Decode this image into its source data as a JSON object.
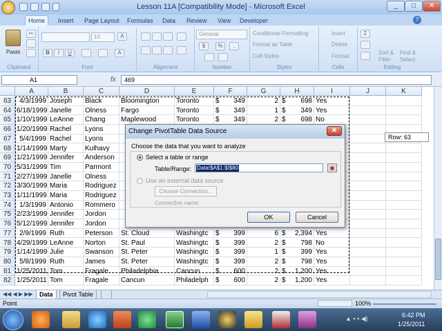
{
  "window": {
    "title": "Lesson 11A  [Compatibility Mode] - Microsoft Excel"
  },
  "ribbon": {
    "tabs": [
      "Home",
      "Insert",
      "Page Layout",
      "Formulas",
      "Data",
      "Review",
      "View",
      "Developer"
    ],
    "groups": {
      "clipboard": {
        "label": "Clipboard",
        "paste": "Paste"
      },
      "font": {
        "label": "Font",
        "size": "10"
      },
      "alignment": {
        "label": "Alignment"
      },
      "number": {
        "label": "Number",
        "format": "General"
      },
      "styles": {
        "label": "Styles",
        "conditional": "Conditional Formatting",
        "table": "Format as Table",
        "cell": "Cell Styles"
      },
      "cells": {
        "label": "Cells",
        "insert": "Insert",
        "delete": "Delete",
        "format": "Format"
      },
      "editing": {
        "label": "Editing",
        "sort": "Sort &",
        "sort2": "Filter",
        "find": "Find &",
        "find2": "Select"
      }
    }
  },
  "formula": {
    "namebox": "A1",
    "fx": "fx",
    "value": "469"
  },
  "grid": {
    "columns": [
      "A",
      "B",
      "C",
      "D",
      "E",
      "F",
      "G",
      "H",
      "I",
      "J",
      "K"
    ],
    "rows": [
      {
        "n": "63",
        "a": "4/3/1999",
        "b": "Joseph",
        "c": "Black",
        "d": "Bloomington",
        "e": "Toronto",
        "f1": "$",
        "f2": "349",
        "g": "2",
        "h1": "$",
        "h2": "698",
        "i": "Yes"
      },
      {
        "n": "64",
        "a": "6/18/1999",
        "b": "Janelle",
        "c": "Olness",
        "d": "Fargo",
        "e": "Toronto",
        "f1": "$",
        "f2": "349",
        "g": "1",
        "h1": "$",
        "h2": "349",
        "i": "Yes"
      },
      {
        "n": "65",
        "a": "1/10/1999",
        "b": "LeAnne",
        "c": "Chang",
        "d": "Maplewood",
        "e": "Toronto",
        "f1": "$",
        "f2": "349",
        "g": "2",
        "h1": "$",
        "h2": "698",
        "i": "No"
      },
      {
        "n": "66",
        "a": "1/20/1999",
        "b": "Rachel",
        "c": "Lyons",
        "d": "",
        "e": "",
        "f1": "",
        "f2": "",
        "g": "",
        "h1": "",
        "h2": "",
        "i": ""
      },
      {
        "n": "67",
        "a": "5/4/1999",
        "b": "Rachel",
        "c": "Lyons",
        "d": "",
        "e": "",
        "f1": "",
        "f2": "",
        "g": "",
        "h1": "",
        "h2": "",
        "i": ""
      },
      {
        "n": "68",
        "a": "1/14/1999",
        "b": "Marty",
        "c": "Kulhavy",
        "d": "",
        "e": "",
        "f1": "",
        "f2": "",
        "g": "",
        "h1": "",
        "h2": "",
        "i": ""
      },
      {
        "n": "69",
        "a": "1/21/1999",
        "b": "Jennifer",
        "c": "Anderson",
        "d": "",
        "e": "",
        "f1": "",
        "f2": "",
        "g": "",
        "h1": "",
        "h2": "",
        "i": ""
      },
      {
        "n": "70",
        "a": "5/31/1999",
        "b": "Tim",
        "c": "Parmont",
        "d": "",
        "e": "",
        "f1": "",
        "f2": "",
        "g": "",
        "h1": "",
        "h2": "",
        "i": ""
      },
      {
        "n": "71",
        "a": "2/27/1999",
        "b": "Janelle",
        "c": "Olness",
        "d": "",
        "e": "",
        "f1": "",
        "f2": "",
        "g": "",
        "h1": "",
        "h2": "",
        "i": ""
      },
      {
        "n": "72",
        "a": "3/30/1999",
        "b": "Maria",
        "c": "Rodriguez",
        "d": "",
        "e": "",
        "f1": "",
        "f2": "",
        "g": "",
        "h1": "",
        "h2": "",
        "i": ""
      },
      {
        "n": "73",
        "a": "1/11/1999",
        "b": "Maria",
        "c": "Rodriguez",
        "d": "",
        "e": "",
        "f1": "",
        "f2": "",
        "g": "",
        "h1": "",
        "h2": "",
        "i": ""
      },
      {
        "n": "74",
        "a": "1/3/1999",
        "b": "Antonio",
        "c": "Rommero",
        "d": "",
        "e": "",
        "f1": "",
        "f2": "",
        "g": "",
        "h1": "",
        "h2": "",
        "i": ""
      },
      {
        "n": "75",
        "a": "2/23/1999",
        "b": "Jennifer",
        "c": "Jordon",
        "d": "",
        "e": "",
        "f1": "",
        "f2": "",
        "g": "",
        "h1": "",
        "h2": "",
        "i": ""
      },
      {
        "n": "76",
        "a": "5/12/1999",
        "b": "Jennifer",
        "c": "Jordon",
        "d": "",
        "e": "",
        "f1": "",
        "f2": "",
        "g": "",
        "h1": "",
        "h2": "",
        "i": ""
      },
      {
        "n": "77",
        "a": "2/9/1999",
        "b": "Ruth",
        "c": "Peterson",
        "d": "St. Cloud",
        "e": "Washingtc",
        "f1": "$",
        "f2": "399",
        "g": "6",
        "h1": "$",
        "h2": "2,394",
        "i": "Yes"
      },
      {
        "n": "78",
        "a": "4/29/1999",
        "b": "LeAnne",
        "c": "Norton",
        "d": "St. Paul",
        "e": "Washingtc",
        "f1": "$",
        "f2": "399",
        "g": "2",
        "h1": "$",
        "h2": "798",
        "i": "No"
      },
      {
        "n": "79",
        "a": "1/14/1999",
        "b": "Julie",
        "c": "Swanson",
        "d": "St. Peter",
        "e": "Washingtc",
        "f1": "$",
        "f2": "399",
        "g": "1",
        "h1": "$",
        "h2": "399",
        "i": "Yes"
      },
      {
        "n": "80",
        "a": "5/8/1999",
        "b": "Ruth",
        "c": "James",
        "d": "St. Peter",
        "e": "Washingtc",
        "f1": "$",
        "f2": "399",
        "g": "2",
        "h1": "$",
        "h2": "798",
        "i": "Yes"
      },
      {
        "n": "81",
        "a": "1/25/2011",
        "b": "Tom",
        "c": "Fragale",
        "d": "Philadelphia",
        "e": "Cancun",
        "f1": "$",
        "f2": "600",
        "g": "2",
        "h1": "$",
        "h2": "1,200",
        "i": "Yes"
      },
      {
        "n": "82",
        "a": "1/25/2011",
        "b": "Tom",
        "c": "Fragale",
        "d": "Cancun",
        "e": "Philadelph",
        "f1": "$",
        "f2": "600",
        "g": "2",
        "h1": "$",
        "h2": "1,200",
        "i": "Yes"
      }
    ]
  },
  "tooltip": {
    "row": "Row: 63"
  },
  "dialog": {
    "title": "Change PivotTable Data Source",
    "prompt": "Choose the data that you want to analyze",
    "opt1": "Select a table or range",
    "range_label": "Table/Range:",
    "range_value": "Data!$A$1:$I$80",
    "opt2": "Use an external data source",
    "choose": "Choose Connection...",
    "conn_label": "Connection name:",
    "ok": "OK",
    "cancel": "Cancel"
  },
  "sheets": [
    "Data",
    "Pivot Table"
  ],
  "status": {
    "mode": "Point",
    "zoom": "100%"
  },
  "taskbar": {
    "time": "6:42 PM",
    "date": "1/25/2011"
  }
}
